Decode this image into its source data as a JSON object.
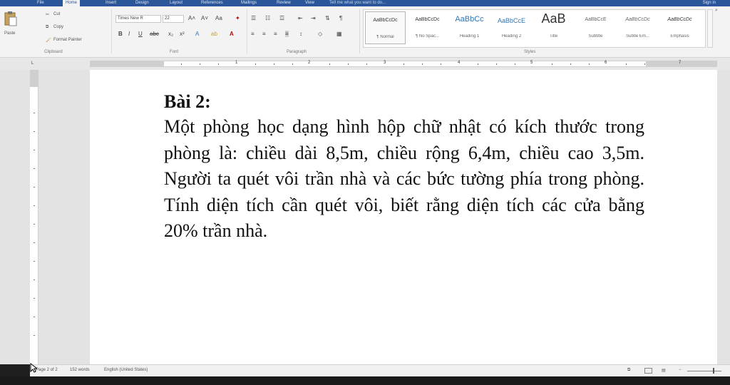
{
  "tabs": [
    "File",
    "Home",
    "Insert",
    "Design",
    "Layout",
    "References",
    "Mailings",
    "Review",
    "View"
  ],
  "tell_me": "Tell me what you want to do...",
  "sign_in": "Sign in",
  "clipboard": {
    "paste": "Paste",
    "cut": "Cut",
    "copy": "Copy",
    "format_painter": "Format Painter",
    "group_label": "Clipboard"
  },
  "font": {
    "name": "Times New R",
    "size": "22",
    "group_label": "Font"
  },
  "paragraph": {
    "group_label": "Paragraph"
  },
  "styles": {
    "group_label": "Styles",
    "items": [
      {
        "preview": "AaBbCcDc",
        "name": "¶ Normal"
      },
      {
        "preview": "AaBbCcDc",
        "name": "¶ No Spac..."
      },
      {
        "preview": "AaBbCc",
        "name": "Heading 1"
      },
      {
        "preview": "AaBbCcE",
        "name": "Heading 2"
      },
      {
        "preview": "AaB",
        "name": "Title"
      },
      {
        "preview": "AaBbCcE",
        "name": "Subtitle"
      },
      {
        "preview": "AaBbCcDc",
        "name": "Subtle Em..."
      },
      {
        "preview": "AaBbCcDc",
        "name": "Emphasis"
      }
    ]
  },
  "ruler_numbers": [
    "1",
    "2",
    "3",
    "4",
    "5",
    "6",
    "7"
  ],
  "document": {
    "heading": "Bài 2:",
    "paragraph": "Một phòng học dạng hình hộp chữ nhật có kích thước trong phòng là: chiều dài 8,5m, chiều rộng 6,4m, chiều cao 3,5m. Người ta quét vôi trần nhà và các bức tường phía trong phòng. Tính diện tích cần quét vôi, biết rằng diện tích các cửa bằng 20% trần nhà."
  },
  "status": {
    "page": "Page 2 of 2",
    "words": "152 words",
    "language": "English (United States)"
  },
  "colors": {
    "tabbar": "#2b579a",
    "ribbon": "#f3f3f3",
    "canvas": "#e3e3e3",
    "heading_style": "#2e74b5"
  }
}
